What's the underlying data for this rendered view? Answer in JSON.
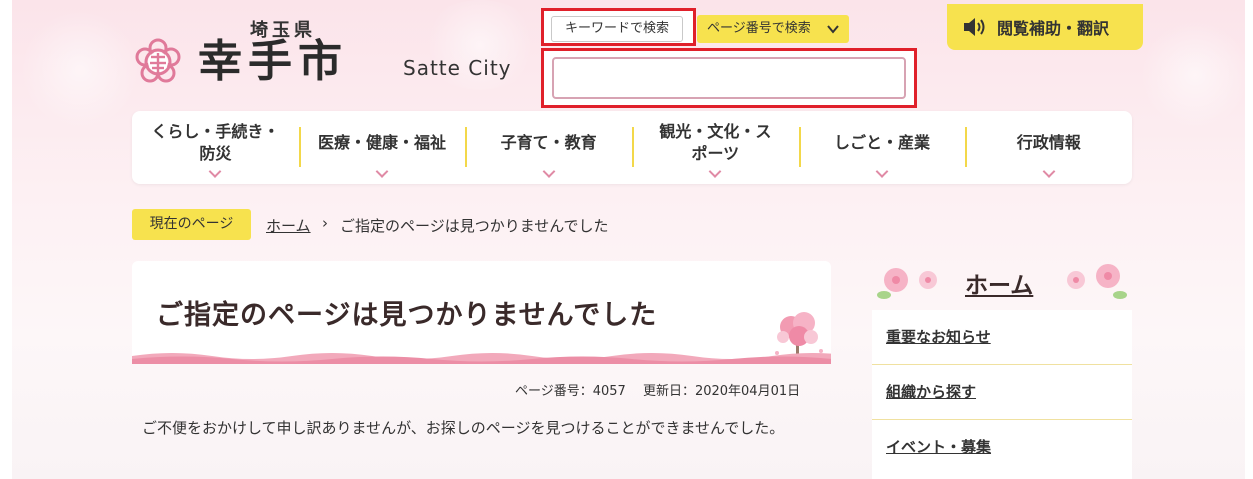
{
  "header": {
    "prefecture": "埼玉県",
    "city_name": "幸手市",
    "city_name_en": "Satte City",
    "search_tabs": {
      "keyword": "キーワードで検索",
      "page_number": "ページ番号で検索"
    },
    "search_input_value": "",
    "accessibility_button": "閲覧補助・翻訳"
  },
  "nav": {
    "items": [
      {
        "label": "くらし・手続き・防災"
      },
      {
        "label": "医療・健康・福祉"
      },
      {
        "label": "子育て・教育"
      },
      {
        "label": "観光・文化・スポーツ"
      },
      {
        "label": "しごと・産業"
      },
      {
        "label": "行政情報"
      }
    ]
  },
  "breadcrumb": {
    "label": "現在のページ",
    "home": "ホーム",
    "separator": "›",
    "current": "ご指定のページは見つかりませんでした"
  },
  "main": {
    "title": "ご指定のページは見つかりませんでした",
    "meta": "ページ番号：4057　 更新日：2020年04月01日",
    "body": "ご不便をおかけして申し訳ありませんが、お探しのページを見つけることができませんでした。"
  },
  "side": {
    "title": "ホーム",
    "items": [
      "重要なお知らせ",
      "組織から探す",
      "イベント・募集"
    ]
  },
  "colors": {
    "accent_yellow": "#f7e24e",
    "highlight_red": "#e0202a",
    "sakura_pink": "#e08aa5"
  }
}
